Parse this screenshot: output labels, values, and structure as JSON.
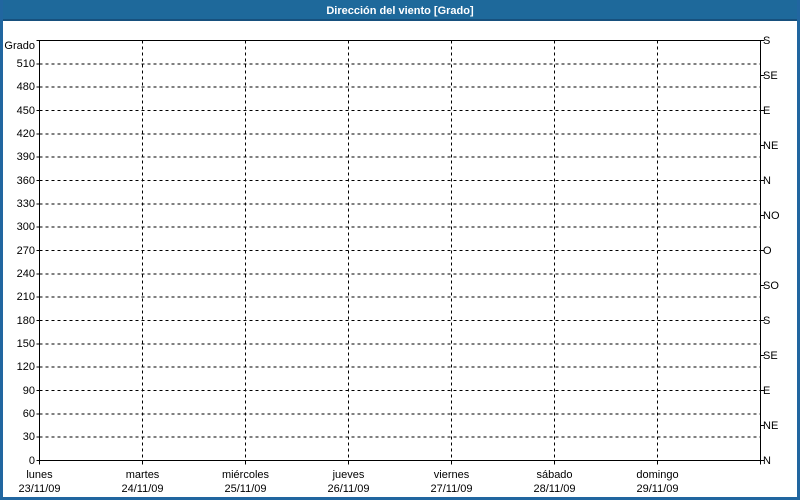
{
  "window": {
    "title": "Dirección del viento [Grado]"
  },
  "colors": {
    "title_bar": "#1e699b",
    "title_bar_underline": "#17507d",
    "window_border": "#2166a0",
    "title_text": "#ffffff",
    "grid": "#000000",
    "label_text": "#000000",
    "plot_background": "#ffffff"
  },
  "chart_data": {
    "type": "line",
    "title": "Dirección del viento [Grado]",
    "ylabel": "Grado",
    "ylim": [
      0,
      540
    ],
    "y_tick_step": 30,
    "y_max_labeled_tick": 510,
    "grid": "dashed",
    "legend": "none",
    "right_axis_tick_step": 45,
    "right_axis_labels_bottom_to_top": [
      "N",
      "NE",
      "E",
      "SE",
      "S",
      "SO",
      "O",
      "NO",
      "N",
      "NE",
      "E",
      "SE",
      "S"
    ],
    "x_axis_days": [
      {
        "weekday": "lunes",
        "date": "23/11/09"
      },
      {
        "weekday": "martes",
        "date": "24/11/09"
      },
      {
        "weekday": "miércoles",
        "date": "25/11/09"
      },
      {
        "weekday": "jueves",
        "date": "26/11/09"
      },
      {
        "weekday": "viernes",
        "date": "27/11/09"
      },
      {
        "weekday": "sábado",
        "date": "28/11/09"
      },
      {
        "weekday": "domingo",
        "date": "29/11/09"
      }
    ],
    "series": []
  }
}
